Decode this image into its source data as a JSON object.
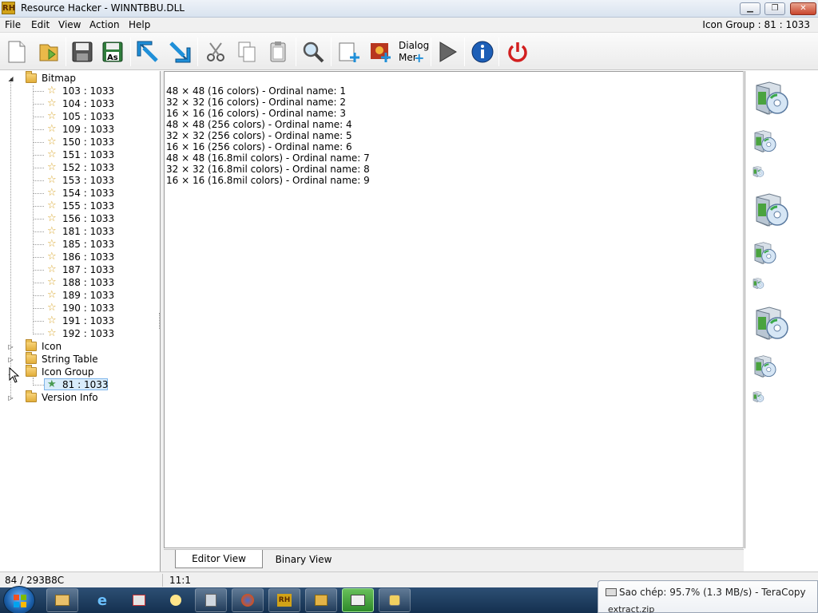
{
  "window": {
    "title": "Resource Hacker - WINNTBBU.DLL",
    "logo": "RH"
  },
  "menu": {
    "items": [
      "File",
      "Edit",
      "View",
      "Action",
      "Help"
    ],
    "right_info": "Icon Group : 81 : 1033"
  },
  "toolbar": {
    "icons": [
      "new-file-icon",
      "open-folder-icon",
      "save-icon",
      "save-as-icon",
      "back-arrow-icon",
      "forward-arrow-icon",
      "cut-icon",
      "copy-icon",
      "paste-icon",
      "search-icon",
      "add-resource-icon",
      "add-image-icon",
      "dialog-merge-icon",
      "run-icon",
      "info-icon",
      "power-icon"
    ],
    "save_as_label": "As",
    "dialog_label_1": "Dialog",
    "dialog_label_2": "Mer"
  },
  "tree": {
    "bitmap": {
      "label": "Bitmap",
      "items": [
        "103 : 1033",
        "104 : 1033",
        "105 : 1033",
        "109 : 1033",
        "150 : 1033",
        "151 : 1033",
        "152 : 1033",
        "153 : 1033",
        "154 : 1033",
        "155 : 1033",
        "156 : 1033",
        "181 : 1033",
        "185 : 1033",
        "186 : 1033",
        "187 : 1033",
        "188 : 1033",
        "189 : 1033",
        "190 : 1033",
        "191 : 1033",
        "192 : 1033"
      ]
    },
    "icon": {
      "label": "Icon"
    },
    "string_table": {
      "label": "String Table"
    },
    "icon_group": {
      "label": "Icon Group",
      "child": "81 : 1033"
    },
    "version_info": {
      "label": "Version Info"
    }
  },
  "editor": {
    "lines": [
      "48 × 48 (16 colors) - Ordinal name: 1",
      "32 × 32 (16 colors) - Ordinal name: 2",
      "16 × 16 (16 colors) - Ordinal name: 3",
      "48 × 48 (256 colors) - Ordinal name: 4",
      "32 × 32 (256 colors) - Ordinal name: 5",
      "16 × 16 (256 colors) - Ordinal name: 6",
      "48 × 48 (16.8mil colors) - Ordinal name: 7",
      "32 × 32 (16.8mil colors) - Ordinal name: 8",
      "16 × 16 (16.8mil colors) - Ordinal name: 9"
    ]
  },
  "tabs": {
    "editor": "Editor View",
    "binary": "Binary View"
  },
  "status": {
    "offset": "84 / 293B8C",
    "position": "11:1"
  },
  "taskbar": {
    "icons": [
      "explorer-icon",
      "ie-icon",
      "network-icon",
      "paint-icon",
      "app-icon",
      "firefox-icon",
      "resource-hacker-icon",
      "package-icon",
      "teracopy-icon",
      "misc-icon"
    ]
  },
  "notification": {
    "text": "Sao chép: 95.7% (1.3 MB/s) - TeraCopy",
    "subtext": "extract.zip"
  },
  "colors": {
    "titlebar": "#d9e3ef",
    "taskbar": "#14304f",
    "folder": "#e2ae3a"
  }
}
